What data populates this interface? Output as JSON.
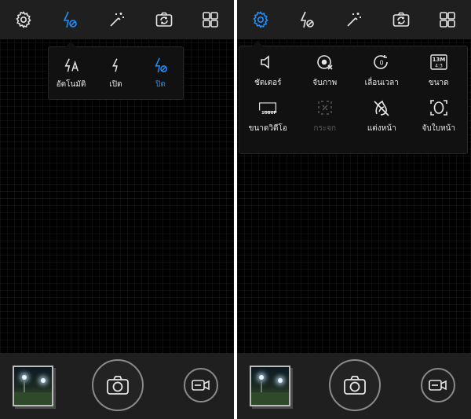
{
  "colors": {
    "accent": "#1e90ff",
    "topbar": "#1f1f1f",
    "viewfinder": "#000000",
    "disabled": "#5a5a5a"
  },
  "left_screen": {
    "topbar": {
      "icons": [
        "settings-gear-icon",
        "flash-off-icon",
        "magic-wand-icon",
        "switch-camera-icon",
        "grid-modes-icon"
      ],
      "active": "flash-off-icon"
    },
    "flash_popup": {
      "options": [
        {
          "label": "อัตโนมัติ",
          "icon": "flash-auto-icon"
        },
        {
          "label": "เปิด",
          "icon": "flash-on-icon"
        },
        {
          "label": "ปิด",
          "icon": "flash-off-icon",
          "selected": true
        }
      ]
    }
  },
  "right_screen": {
    "topbar": {
      "icons": [
        "settings-gear-icon",
        "flash-off-icon",
        "magic-wand-icon",
        "switch-camera-icon",
        "grid-modes-icon"
      ],
      "active": "settings-gear-icon"
    },
    "settings_popup": {
      "items": [
        {
          "label": "ชัตเตอร์",
          "icon": "shutter-sound-icon"
        },
        {
          "label": "จับภาพ",
          "icon": "capture-icon"
        },
        {
          "label": "เลื่อนเวลา",
          "icon": "timer-icon",
          "badge": "0"
        },
        {
          "label": "ขนาด",
          "icon": "photo-size-icon",
          "badge_top": "13M",
          "badge_bottom": "4:3"
        },
        {
          "label": "ขนาดวิดีโอ",
          "icon": "video-size-icon",
          "badge": "1080P"
        },
        {
          "label": "กระจก",
          "icon": "mirror-icon",
          "disabled": true
        },
        {
          "label": "แต่งหน้า",
          "icon": "beauty-off-icon"
        },
        {
          "label": "จับใบหน้า",
          "icon": "face-detect-icon"
        }
      ]
    }
  },
  "bottombar": {
    "gallery": "gallery-thumbnail",
    "shutter": "camera-shutter-icon",
    "video": "video-record-icon"
  }
}
